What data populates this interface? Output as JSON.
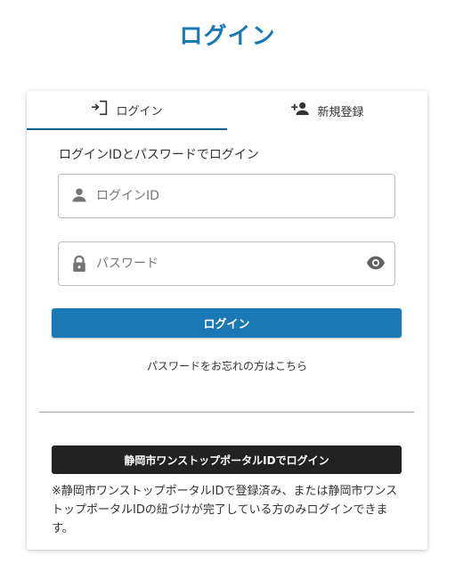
{
  "page": {
    "title": "ログイン"
  },
  "tabs": [
    {
      "label": "ログイン",
      "icon": "login-icon",
      "active": true
    },
    {
      "label": "新規登録",
      "icon": "person-add-icon",
      "active": false
    }
  ],
  "form": {
    "heading": "ログインIDとパスワードでログイン",
    "login_id": {
      "placeholder": "ログインID",
      "value": "",
      "icon": "person-icon"
    },
    "password": {
      "placeholder": "パスワード",
      "value": "",
      "icon": "lock-icon",
      "toggle_icon": "eye-icon"
    },
    "submit_label": "ログイン",
    "forgot_link": "パスワードをお忘れの方はこちら"
  },
  "portal": {
    "button_label": "静岡市ワンストップポータルIDでログイン",
    "note": "※静岡市ワンストップポータルIDで登録済み、または静岡市ワンストップポータルIDの紐づけが完了している方のみログインできます。"
  },
  "colors": {
    "accent": "#1a78b4",
    "dark_button": "#222222",
    "active_tab_underline": "#0f5f8f"
  }
}
